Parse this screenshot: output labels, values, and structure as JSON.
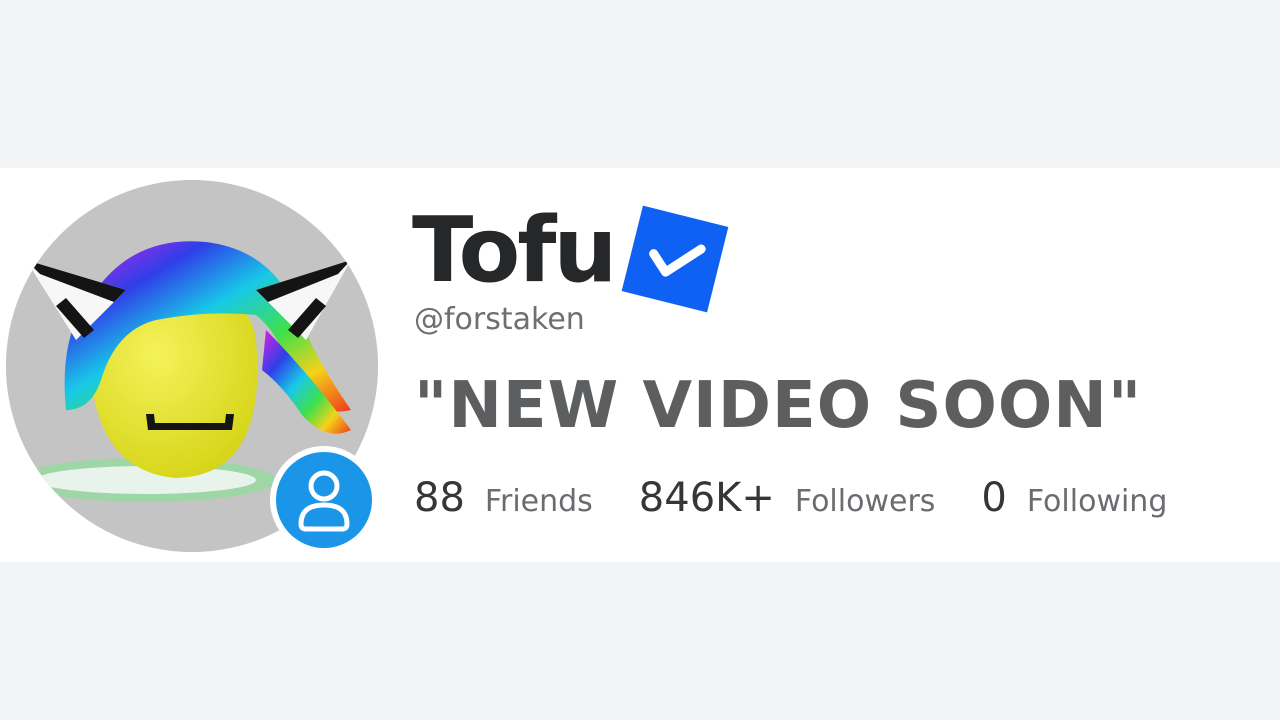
{
  "profile": {
    "display_name": "Tofu",
    "username": "@forstaken",
    "status": "\"NEW VIDEO SOON\"",
    "verified_icon": "verified-checkmark-icon",
    "presence_icon": "person-icon"
  },
  "stats": {
    "friends": {
      "count": "88",
      "label": "Friends"
    },
    "followers": {
      "count": "846K+",
      "label": "Followers"
    },
    "following": {
      "count": "0",
      "label": "Following"
    }
  },
  "colors": {
    "verified_badge": "#0e61f3",
    "presence_badge": "#1b95e8",
    "banner": "#ffffff",
    "page_background": "#f2f3f5"
  }
}
